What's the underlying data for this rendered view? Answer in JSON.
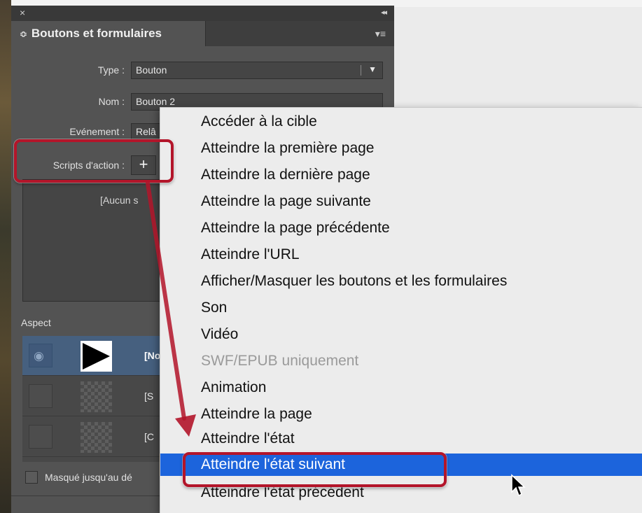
{
  "panel": {
    "close_glyph": "×",
    "collapse_glyph": "◂◂",
    "tab_arrows": "≎",
    "title": "Boutons et formulaires",
    "menu_glyph": "▾≡",
    "type_label": "Type :",
    "type_value": "Bouton",
    "name_label": "Nom :",
    "name_value": "Bouton 2",
    "event_label": "Evénement :",
    "event_value": "Relâ",
    "scripts_label": "Scripts d'action :",
    "plus_glyph": "+",
    "actions_empty": "[Aucun s",
    "aspect_label": "Aspect",
    "states": [
      {
        "name": "[No",
        "thumbnail": "play"
      },
      {
        "name": "[S",
        "thumbnail": "empty"
      },
      {
        "name": "[C",
        "thumbnail": "empty"
      }
    ],
    "hidden_label": "Masqué jusqu'au dé"
  },
  "menu": {
    "items": [
      {
        "label": "Accéder à la cible",
        "state": "normal"
      },
      {
        "label": "Atteindre la première page",
        "state": "normal"
      },
      {
        "label": "Atteindre la dernière page",
        "state": "normal"
      },
      {
        "label": "Atteindre la page suivante",
        "state": "normal"
      },
      {
        "label": "Atteindre la page précédente",
        "state": "normal"
      },
      {
        "label": "Atteindre l'URL",
        "state": "normal"
      },
      {
        "label": "Afficher/Masquer les boutons et les formulaires",
        "state": "normal"
      },
      {
        "label": "Son",
        "state": "normal"
      },
      {
        "label": "Vidéo",
        "state": "normal"
      },
      {
        "label": "SWF/EPUB uniquement",
        "state": "disabled"
      },
      {
        "label": "Animation",
        "state": "normal"
      },
      {
        "label": "Atteindre la page",
        "state": "normal"
      },
      {
        "label": "Atteindre l'état",
        "state": "normal"
      },
      {
        "label": "Atteindre l'état suivant",
        "state": "selected"
      },
      {
        "label": "Atteindre l'état précédent",
        "state": "normal"
      }
    ]
  },
  "colors": {
    "panel_bg": "#535353",
    "menu_bg": "#ececec",
    "menu_highlight": "#1c64dc",
    "annotation_red": "#b3152a"
  }
}
